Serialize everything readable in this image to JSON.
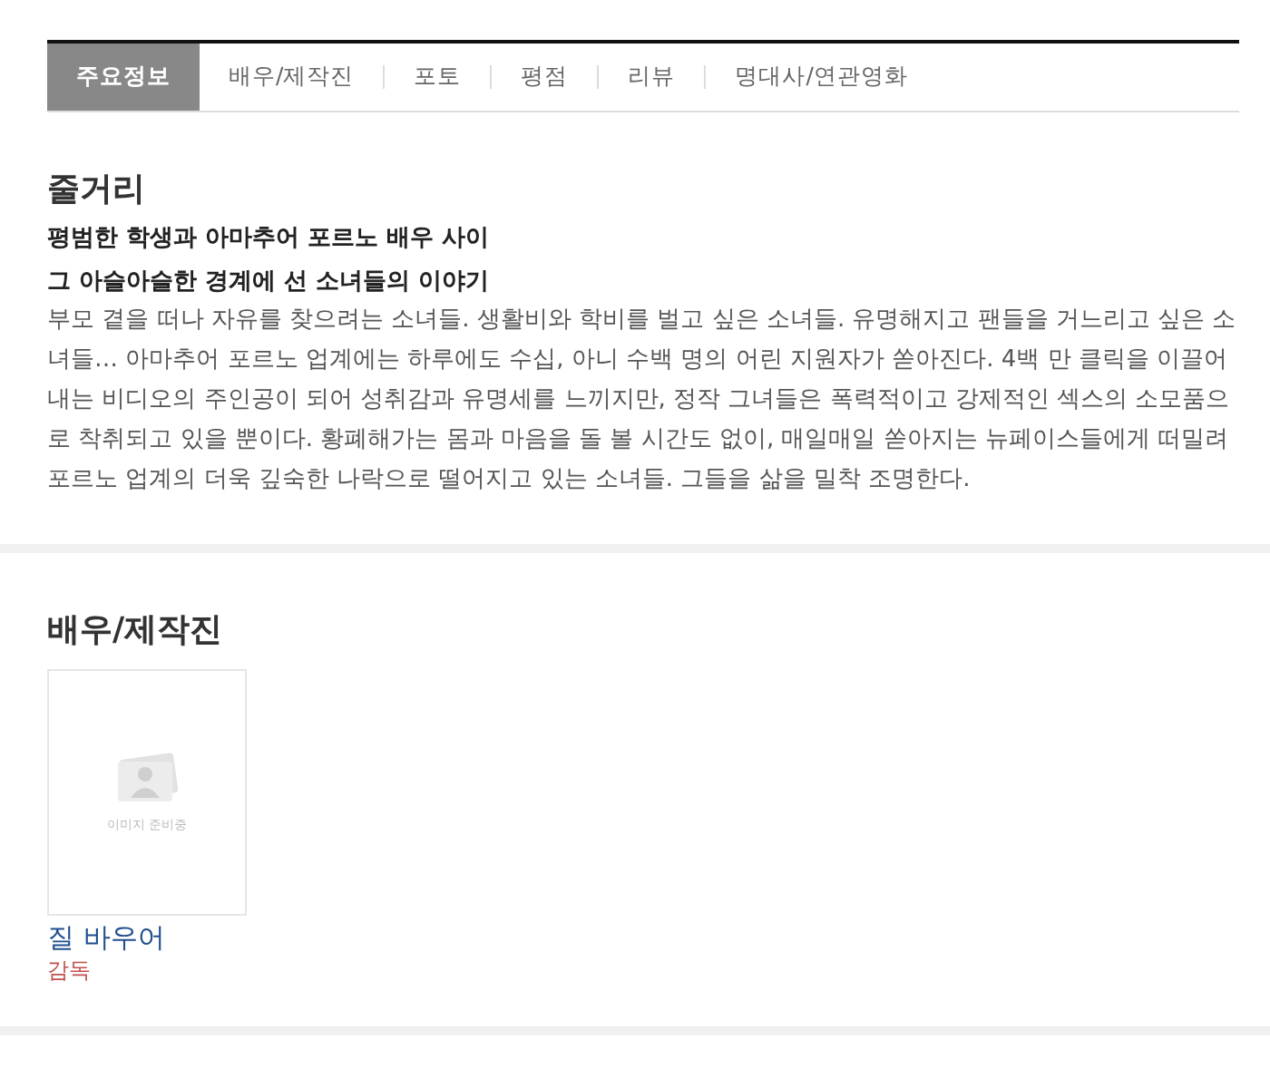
{
  "tabs": [
    {
      "label": "주요정보",
      "selected": true
    },
    {
      "label": "배우/제작진",
      "selected": false
    },
    {
      "label": "포토",
      "selected": false
    },
    {
      "label": "평점",
      "selected": false
    },
    {
      "label": "리뷰",
      "selected": false
    },
    {
      "label": "명대사/연관영화",
      "selected": false
    }
  ],
  "synopsis": {
    "heading": "줄거리",
    "tagline": [
      "평범한 학생과 아마추어 포르노 배우 사이",
      "그 아슬아슬한 경계에 선 소녀들의 이야기"
    ],
    "body": "부모 곁을 떠나 자유를 찾으려는 소녀들. 생활비와 학비를 벌고 싶은 소녀들. 유명해지고 팬들을 거느리고 싶은 소녀들… 아마추어 포르노 업계에는 하루에도 수십, 아니 수백 명의 어린 지원자가 쏟아진다. 4백 만 클릭을 이끌어내는 비디오의 주인공이 되어 성취감과 유명세를 느끼지만, 정작 그녀들은 폭력적이고 강제적인 섹스의 소모품으로 착취되고 있을 뿐이다. 황폐해가는 몸과 마음을 돌 볼 시간도 없이, 매일매일 쏟아지는 뉴페이스들에게 떠밀려 포르노 업계의 더욱 깊숙한 나락으로 떨어지고 있는 소녀들. 그들을 삶을 밀착 조명한다."
  },
  "cast": {
    "heading": "배우/제작진",
    "people": [
      {
        "name": "질 바우어",
        "role": "감독",
        "photo_placeholder": "이미지 준비중"
      }
    ]
  }
}
